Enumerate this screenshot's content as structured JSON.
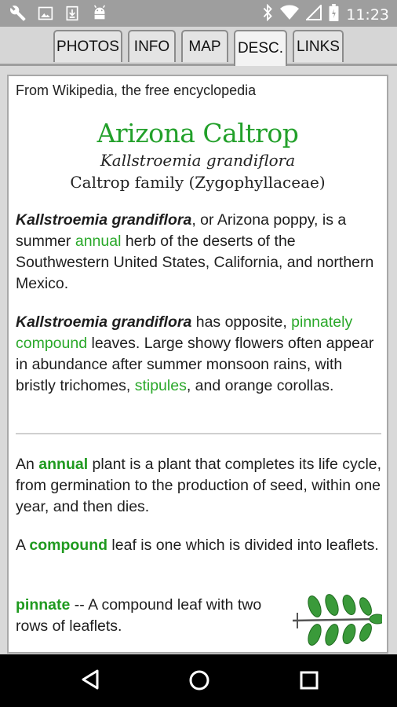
{
  "status_bar": {
    "time": "11:23",
    "left_icons": [
      "wrench-icon",
      "image-icon",
      "download-icon",
      "android-icon"
    ],
    "right_icons": [
      "bluetooth-icon",
      "wifi-icon",
      "signal-icon",
      "battery-icon"
    ]
  },
  "tabs": [
    {
      "label": "PHOTOS",
      "active": false
    },
    {
      "label": "INFO",
      "active": false
    },
    {
      "label": "MAP",
      "active": false
    },
    {
      "label": "DESC.",
      "active": true
    },
    {
      "label": "LINKS",
      "active": false
    }
  ],
  "article": {
    "source": "From Wikipedia, the free encyclopedia",
    "title": "Arizona Caltrop",
    "scientific_name": "Kallstroemia grandiflora",
    "family": "Caltrop family (Zygophyllaceae)",
    "p1": {
      "name": "Kallstroemia grandiflora",
      "t1": ", or Arizona poppy, is a summer ",
      "link1": "annual",
      "t2": " herb of the deserts of the Southwestern United States, California, and northern Mexico."
    },
    "p2": {
      "name": "Kallstroemia grandiflora",
      "t1": " has opposite, ",
      "link1": "pinnately compound",
      "t2": " leaves. Large showy flowers often appear in abundance after summer monsoon rains, with bristly trichomes, ",
      "link2": "stipules",
      "t3": ", and orange corollas."
    }
  },
  "glossary": {
    "annual": {
      "pre": "An ",
      "term": "annual",
      "text": " plant is a plant that completes its life cycle, from germination to the production of seed, within one year, and then dies."
    },
    "compound": {
      "pre": "A ",
      "term": "compound",
      "text": " leaf is one which is divided into leaflets."
    },
    "pinnate": {
      "term": "pinnate",
      "text": " -- A compound leaf with two rows of leaflets."
    }
  },
  "colors": {
    "accent_green": "#22a02a",
    "status_bar": "#9e9e9e",
    "nav_bar": "#000000"
  },
  "nav_bar": [
    "back-icon",
    "home-icon",
    "recents-icon"
  ]
}
